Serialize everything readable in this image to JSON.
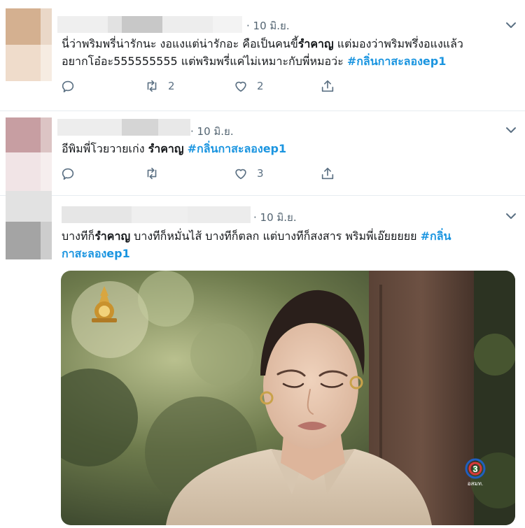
{
  "tweets": [
    {
      "time": "· 10 มิ.ย.",
      "text_parts": [
        "นี่ว่าพริมพรี่น่ารักนะ งอแงแต่น่ารักอะ คือเป็นคนขี้",
        "รำคาญ",
        " แต่มองว่าพริมพรึ่งอแงแล้ว",
        "อยากโอ๋อะ555555555 แต่พริมพรี่แค่ไม่เหมาะกับพี่หมอว่ะ ",
        "#กลิ่นกาสะลองep1"
      ],
      "retweets": "2",
      "likes": "2"
    },
    {
      "time": "· 10 มิ.ย.",
      "text_parts": [
        "อีพิมพี่โวยวายเก่ง ",
        "รำคาญ",
        " ",
        "#กลิ่นกาสะลองep1"
      ],
      "retweets": "",
      "likes": "3"
    },
    {
      "time": "· 10 มิ.ย.",
      "text_parts": [
        "บางทีก็",
        "รำคาญ",
        " บางทีก็หมั่นไส้ บางทีก็ตลก แต่บางทีก็สงสาร พริมพี่เอ๊ยยยยย ",
        "#กลิ่น",
        "กาสะลองep1"
      ],
      "media": {
        "channel_logo": "3",
        "channel_caption": "อสมท."
      }
    }
  ],
  "icons": {
    "reply": "reply-icon",
    "retweet": "retweet-icon",
    "like": "heart-icon",
    "share": "share-icon",
    "menu": "chevron-down-icon"
  },
  "colors": {
    "hashtag": "#1b95e0",
    "secondary_text": "#5b7083",
    "divider": "#e6ecf0"
  }
}
